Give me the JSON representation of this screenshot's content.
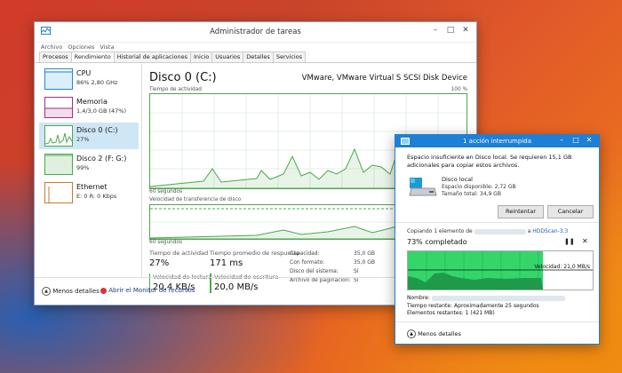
{
  "taskmanager": {
    "title": "Administrador de tareas",
    "menu": [
      "Archivo",
      "Opciones",
      "Vista"
    ],
    "tabs": [
      "Procesos",
      "Rendimiento",
      "Historial de aplicaciones",
      "Inicio",
      "Usuarios",
      "Detalles",
      "Servicios"
    ],
    "active_tab": "Rendimiento",
    "sidebar": [
      {
        "name": "CPU",
        "sub": "86% 2,80 GHz",
        "color": "#1e8ad6"
      },
      {
        "name": "Memoria",
        "sub": "1,4/3,0 GB (47%)",
        "color": "#a0307a"
      },
      {
        "name": "Disco 0 (C:)",
        "sub": "27%",
        "color": "#4aa84a"
      },
      {
        "name": "Disco 2 (F: G:)",
        "sub": "99%",
        "color": "#4aa84a"
      },
      {
        "name": "Ethernet",
        "sub": "E: 0 R: 0 Kbps",
        "color": "#c87a28"
      }
    ],
    "main": {
      "title": "Disco 0 (C:)",
      "device": "VMware, VMware Virtual S SCSI Disk Device",
      "graph1_label": "Tiempo de actividad",
      "graph1_max": "100 %",
      "graph1_time": "60 segundos",
      "graph2_label": "Velocidad de transferencia de disco",
      "graph2_time": "60 segundos",
      "stats": {
        "activity_label": "Tiempo de actividad",
        "activity_value": "27%",
        "response_label": "Tiempo promedio de respuesta",
        "response_value": "171 ms",
        "read_label": "Velocidad de lectura",
        "read_value": "20,4 KB/s",
        "write_label": "Velocidad de escritura",
        "write_value": "20,0 MB/s"
      },
      "info": [
        {
          "k": "Capacidad:",
          "v": "35,0 GB"
        },
        {
          "k": "Con formato:",
          "v": "35,0 GB"
        },
        {
          "k": "Disco del sistema:",
          "v": "Sí"
        },
        {
          "k": "Archivo de paginación:",
          "v": "Sí"
        }
      ]
    },
    "footer": {
      "less_details": "Menos detalles",
      "resource_monitor": "Abrir el Monitor de recursos"
    }
  },
  "dialog": {
    "title": "1 acción interrumpida",
    "message": "Espacio insuficiente en Disco local. Se requieren 15,1 GB adicionales para copiar estos archivos.",
    "disk_name": "Disco local",
    "disk_free": "Espacio disponible: 2,72 GB",
    "disk_total": "Tamaño total: 34,9 GB",
    "retry": "Reintentar",
    "cancel": "Cancelar",
    "copying_prefix": "Copiando 1 elemento de",
    "copying_to": "a",
    "dest": "HDDScan-3.3",
    "progress_text": "73% completado",
    "progress": 0.73,
    "speed": "Velocidad: 21,0 MB/s",
    "name_label": "Nombre:",
    "time_left": "Tiempo restante: Aproximadamente 25 segundos",
    "items_left": "Elementos restantes: 1 (421 MB)",
    "less_details": "Menos detalles"
  }
}
